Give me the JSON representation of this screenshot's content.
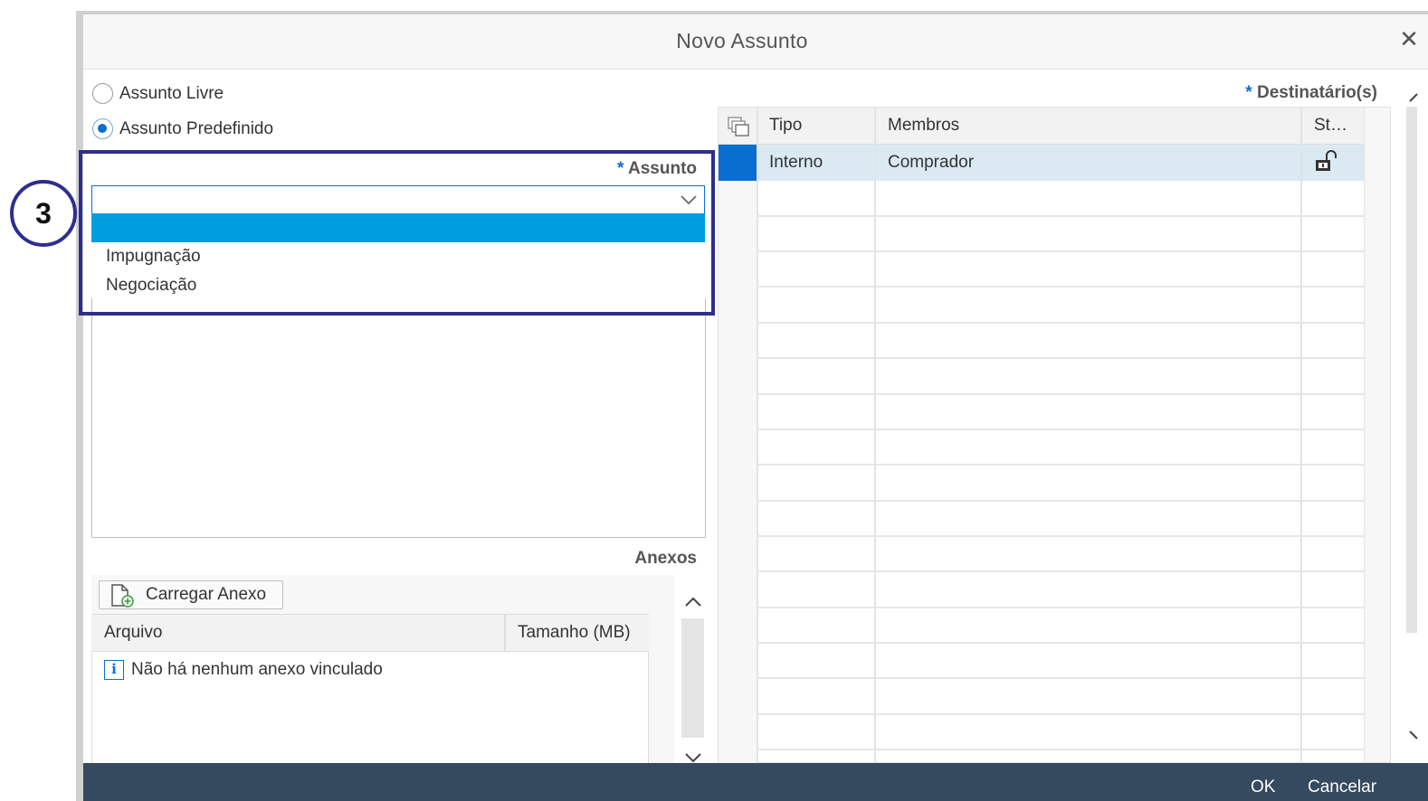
{
  "dialog": {
    "title": "Novo Assunto",
    "close_glyph": "✕"
  },
  "subject_type": {
    "options": [
      {
        "label": "Assunto Livre",
        "selected": false
      },
      {
        "label": "Assunto Predefinido",
        "selected": true
      }
    ]
  },
  "subject_field": {
    "required_mark": "*",
    "label": "Assunto",
    "value": "",
    "dropdown_options": [
      "",
      "Impugnação",
      "Negociação"
    ],
    "highlighted_option_index": 0
  },
  "annotation": {
    "step_number": "3"
  },
  "attachments": {
    "section_label": "Anexos",
    "upload_button": "Carregar Anexo",
    "columns": [
      "Arquivo",
      "Tamanho (MB)"
    ],
    "empty_message": "Não há nenhum anexo vinculado"
  },
  "recipients": {
    "required_mark": "*",
    "label": "Destinatário(s)",
    "columns": [
      "Tipo",
      "Membros",
      "St…"
    ],
    "rows": [
      {
        "tipo": "Interno",
        "membros": "Comprador",
        "status_icon": "unlocked-padlock-icon"
      }
    ]
  },
  "footer": {
    "ok_label": "OK",
    "cancel_label": "Cancelar"
  },
  "colors": {
    "accent": "#0a6ed1",
    "dropdown_highlight": "#009de0",
    "annotation": "#2e2e8f",
    "footer_bg": "#354a5f",
    "row_selected_bg": "#dbe9f3"
  }
}
